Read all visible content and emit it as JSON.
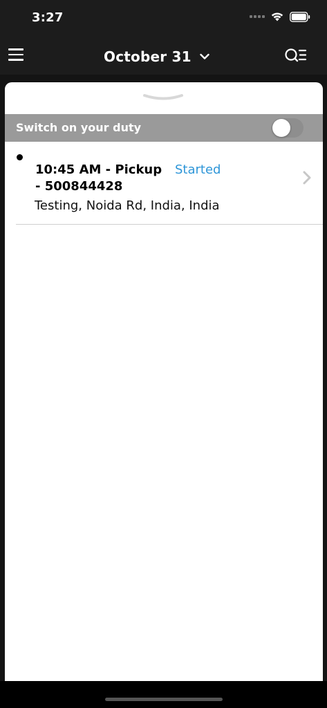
{
  "status_bar": {
    "time": "3:27"
  },
  "nav": {
    "date_label": "October 31",
    "icons": {
      "menu": "hamburger-menu-icon",
      "date_dropdown": "chevron-down-icon",
      "search": "search-list-icon"
    }
  },
  "duty": {
    "label": "Switch on your duty",
    "toggle_on": false
  },
  "jobs": [
    {
      "time_type": "10:45 AM - Pickup",
      "status": "Started",
      "id": "- 500844428",
      "address": "Testing, Noida Rd, India, India"
    }
  ],
  "colors": {
    "header_bg": "#1c1c1c",
    "duty_bar_bg": "#9a9a9a",
    "status_blue": "#2e96d8",
    "sheet_bg": "#ffffff"
  }
}
